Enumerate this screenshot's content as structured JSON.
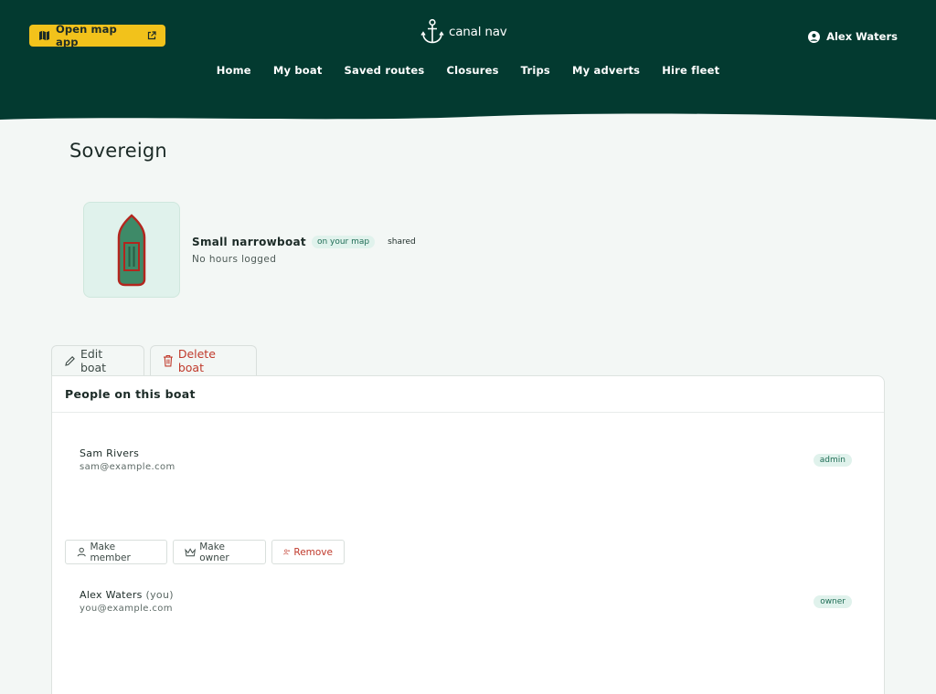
{
  "header": {
    "open_map_label": "Open map app",
    "logo_text": "canal nav",
    "user_name": "Alex Waters",
    "nav": [
      "Home",
      "My boat",
      "Saved routes",
      "Closures",
      "Trips",
      "My adverts",
      "Hire fleet"
    ]
  },
  "boat": {
    "name": "Sovereign",
    "type": "Small narrowboat",
    "badge_map": "on your map",
    "badge_shared": "shared",
    "hours": "No hours logged"
  },
  "actions": {
    "edit": "Edit boat",
    "delete": "Delete boat"
  },
  "people": {
    "title": "People on this boat",
    "members": [
      {
        "name": "Sam Rivers",
        "you": "",
        "email": "sam@example.com",
        "role": "admin"
      },
      {
        "name": "Alex Waters",
        "you": "(you)",
        "email": "you@example.com",
        "role": "owner"
      }
    ],
    "buttons": {
      "make_member": "Make member",
      "make_owner": "Make owner",
      "remove": "Remove"
    }
  },
  "colors": {
    "header_bg": "#033a30",
    "accent_yellow": "#f2c21b",
    "danger": "#c0392b",
    "badge_bg": "#e0f2ec"
  }
}
